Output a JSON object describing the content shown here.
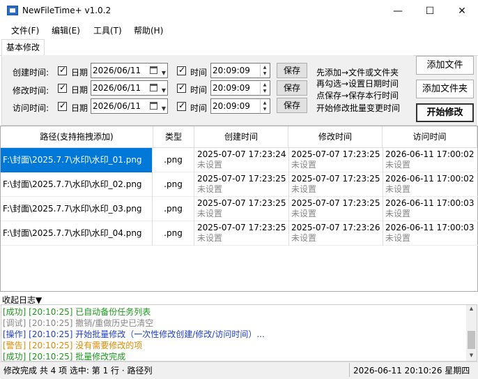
{
  "window": {
    "title": "NewFileTime+ v1.0.2",
    "controls": {
      "minimize": "—",
      "maximize": "☐",
      "close": "✕"
    }
  },
  "menu": [
    "文件(F)",
    "编辑(E)",
    "工具(T)",
    "帮助(H)"
  ],
  "tabs": [
    "基本修改"
  ],
  "options": {
    "rows": [
      {
        "label": "创建时间:",
        "date_label": "日期",
        "date": "2026/06/11",
        "time_label": "时间",
        "time": "20:09:09",
        "save": "保存"
      },
      {
        "label": "修改时间:",
        "date_label": "日期",
        "date": "2026/06/11",
        "time_label": "时间",
        "time": "20:09:09",
        "save": "保存"
      },
      {
        "label": "访问时间:",
        "date_label": "日期",
        "date": "2026/06/11",
        "time_label": "时间",
        "time": "20:09:09",
        "save": "保存"
      }
    ],
    "hints": [
      "先添加→文件或文件夹",
      "再勾选→设置日期时间",
      "点保存→保存本行时间",
      "开始修改批量变更时间"
    ]
  },
  "actions": {
    "add_file": "添加文件",
    "add_folder": "添加文件夹",
    "start": "开始修改"
  },
  "table": {
    "columns": [
      "路径(支持拖拽添加)",
      "类型",
      "创建时间",
      "修改时间",
      "访问时间"
    ],
    "rows": [
      {
        "path": "F:\\封面\\2025.7.7\\水印\\水印_01.png",
        "type": ".png",
        "created": "2025-07-07 17:23:24",
        "created_sub": "未设置",
        "modified": "2025-07-07 17:23:25",
        "modified_sub": "未设置",
        "accessed": "2026-06-11 17:00:02",
        "accessed_sub": "未设置"
      },
      {
        "path": "F:\\封面\\2025.7.7\\水印\\水印_02.png",
        "type": ".png",
        "created": "2025-07-07 17:23:25",
        "created_sub": "未设置",
        "modified": "2025-07-07 17:23:25",
        "modified_sub": "未设置",
        "accessed": "2026-06-11 17:00:02",
        "accessed_sub": "未设置"
      },
      {
        "path": "F:\\封面\\2025.7.7\\水印\\水印_03.png",
        "type": ".png",
        "created": "2025-07-07 17:23:25",
        "created_sub": "未设置",
        "modified": "2025-07-07 17:23:25",
        "modified_sub": "未设置",
        "accessed": "2026-06-11 17:00:03",
        "accessed_sub": "未设置"
      },
      {
        "path": "F:\\封面\\2025.7.7\\水印\\水印_04.png",
        "type": ".png",
        "created": "2025-07-07 17:23:25",
        "created_sub": "未设置",
        "modified": "2025-07-07 17:23:26",
        "modified_sub": "未设置",
        "accessed": "2026-06-11 17:00:03",
        "accessed_sub": "未设置"
      }
    ]
  },
  "log": {
    "header": "收起日志▼",
    "lines": [
      {
        "text": "[成功] [20:10:25] 已自动备份任务列表",
        "color": "#1a9a1a"
      },
      {
        "text": "[调试] [20:10:25] 撤销/重做历史已清空",
        "color": "#888888"
      },
      {
        "text": "[操作] [20:10:25] 开始批量修改（一次性修改创建/修改/访问时间）...",
        "color": "#1f3fcf"
      },
      {
        "text": "[警告] [20:10:25] 没有需要修改的项",
        "color": "#e08a00"
      },
      {
        "text": "[成功] [20:10:25] 批量修改完成",
        "color": "#1a9a1a"
      }
    ]
  },
  "status": {
    "left": "修改完成  共 4 项  选中: 第 1 行 · 路径列",
    "right": "2026-06-11 20:10:26 星期四"
  }
}
